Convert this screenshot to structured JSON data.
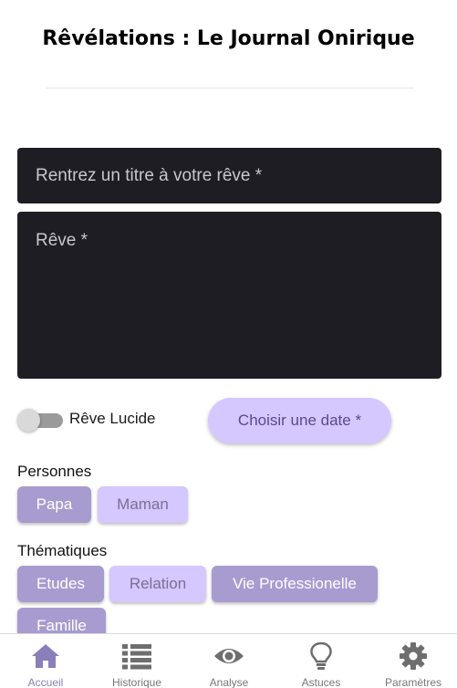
{
  "header": {
    "title": "Rêvélations : Le Journal Onirique"
  },
  "form": {
    "title_placeholder": "Rentrez un titre à votre rêve *",
    "dream_placeholder": "Rêve *",
    "lucid_label": "Rêve Lucide",
    "lucid_on": false,
    "date_button": "Choisir une date *"
  },
  "personnes": {
    "label": "Personnes",
    "chips": [
      {
        "label": "Papa",
        "selected": true
      },
      {
        "label": "Maman",
        "selected": false
      }
    ]
  },
  "thematiques": {
    "label": "Thématiques",
    "chips": [
      {
        "label": "Etudes",
        "selected": true
      },
      {
        "label": "Relation",
        "selected": false
      },
      {
        "label": "Vie Professionelle",
        "selected": true
      },
      {
        "label": "Famille",
        "selected": true
      }
    ]
  },
  "nav": {
    "items": [
      {
        "label": "Accueil",
        "icon": "home-icon",
        "active": true
      },
      {
        "label": "Historique",
        "icon": "list-icon",
        "active": false
      },
      {
        "label": "Analyse",
        "icon": "eye-icon",
        "active": false
      },
      {
        "label": "Astuces",
        "icon": "lightbulb-icon",
        "active": false
      },
      {
        "label": "Paramètres",
        "icon": "gear-icon",
        "active": false
      }
    ]
  },
  "colors": {
    "accent": "#a89bd0",
    "accent_light": "#d5c7ff",
    "field_bg": "#1f1d24",
    "nav_active": "#8a7fb8",
    "nav_inactive": "#777777"
  }
}
